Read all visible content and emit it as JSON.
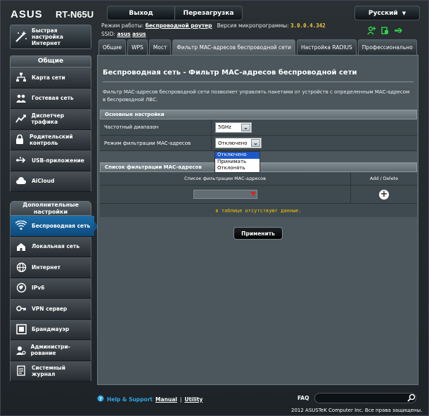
{
  "brand": {
    "logo": "ASUS",
    "model": "RT-N65U"
  },
  "topbar": {
    "logout": "Выход",
    "reboot": "Перезагрузка",
    "language": "Русский"
  },
  "status": {
    "mode_label": "Режим работы:",
    "mode_value": "беспроводной роутер",
    "fw_label": "Версия микропрограммы:",
    "fw_value": "3.0.0.4.342",
    "ssid_label": "SSID:",
    "ssid_1": "asus",
    "ssid_2": "asus"
  },
  "sidebar": {
    "quick_setup": "Быстрая настройка Интернет",
    "general_header": "Общие",
    "general_items": [
      {
        "label": "Карта сети",
        "icon": "network-map-icon"
      },
      {
        "label": "Гостевая сеть",
        "icon": "guest-network-icon"
      },
      {
        "label": "Диспетчер трафика",
        "icon": "traffic-manager-icon"
      },
      {
        "label": "Родительский контроль",
        "icon": "parental-control-icon"
      },
      {
        "label": "USB-приложение",
        "icon": "usb-app-icon"
      },
      {
        "label": "AiCloud",
        "icon": "aicloud-icon"
      }
    ],
    "advanced_header": "Дополнительные настройки",
    "advanced_items": [
      {
        "label": "Беспроводная сеть",
        "icon": "wireless-icon",
        "active": true
      },
      {
        "label": "Локальная сеть",
        "icon": "lan-icon"
      },
      {
        "label": "Интернет",
        "icon": "internet-icon"
      },
      {
        "label": "IPv6",
        "icon": "ipv6-icon"
      },
      {
        "label": "VPN сервер",
        "icon": "vpn-icon"
      },
      {
        "label": "Брандмауэр",
        "icon": "firewall-icon"
      },
      {
        "label": "Администри-рование",
        "icon": "admin-icon"
      },
      {
        "label": "Системный журнал",
        "icon": "syslog-icon"
      }
    ]
  },
  "tabs": [
    {
      "label": "Общие"
    },
    {
      "label": "WPS"
    },
    {
      "label": "Мост"
    },
    {
      "label": "Фильтр MAC-адресов беспроводной сети",
      "active": true
    },
    {
      "label": "Настройка RADIUS"
    },
    {
      "label": "Профессионально"
    }
  ],
  "page": {
    "title": "Беспроводная сеть - Фильтр MAC-адресов беспроводной сети",
    "description": "Фильтр MAC-адресов беспроводной сети позволяет управлять пакетами от устройств с определенным MAC-адресом в беспроводной ЛВС.",
    "basic_header": "Основные настройки",
    "band_label": "Частотный диапазон",
    "band_value": "5GHz",
    "mode_label": "Режим фильтрации MAC-адресов",
    "mode_value": "Отключено",
    "mode_options": [
      "Отключено",
      "Принимать",
      "Отклонять"
    ],
    "list_header": "Список фильтрации MAC-адресов",
    "list_col1": "Список фильтрации MAC-адресов",
    "list_col2": "Add / Delete",
    "empty_msg": "в таблице отсутствуют данные.",
    "apply": "Применить"
  },
  "footer": {
    "help": "Help & Support",
    "manual": "Manual",
    "sep": "|",
    "utility": "Utility",
    "faq": "FAQ",
    "copyright": "2012 ASUSTeK Computer Inc. Все права защищены."
  }
}
